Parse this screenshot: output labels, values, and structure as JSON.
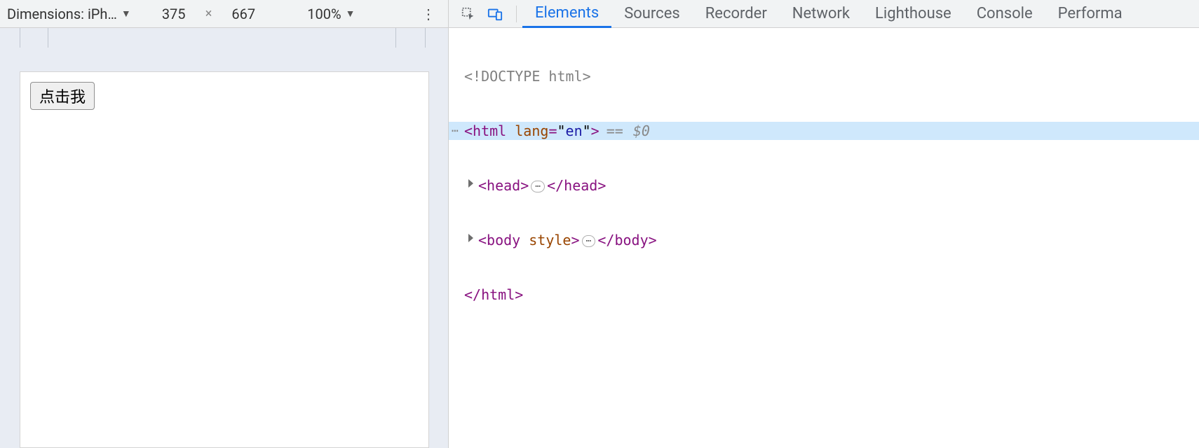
{
  "deviceToolbar": {
    "dimensionsLabel": "Dimensions: iPh…",
    "width": "375",
    "height": "667",
    "separator": "×",
    "zoom": "100%"
  },
  "page": {
    "buttonLabel": "点击我"
  },
  "devtoolsTabs": {
    "elements": "Elements",
    "sources": "Sources",
    "recorder": "Recorder",
    "network": "Network",
    "lighthouse": "Lighthouse",
    "console": "Console",
    "performance": "Performa"
  },
  "dom": {
    "doctype": "<!DOCTYPE html>",
    "htmlOpen": "html",
    "htmlAttrName": "lang",
    "htmlAttrVal": "en",
    "selEq": "==",
    "selHint": "$0",
    "headOpen": "head",
    "headClose": "/head",
    "bodyOpen": "body",
    "bodyAttr": "style",
    "bodyClose": "/body",
    "htmlClose": "/html",
    "ellipsis": "⋯"
  }
}
